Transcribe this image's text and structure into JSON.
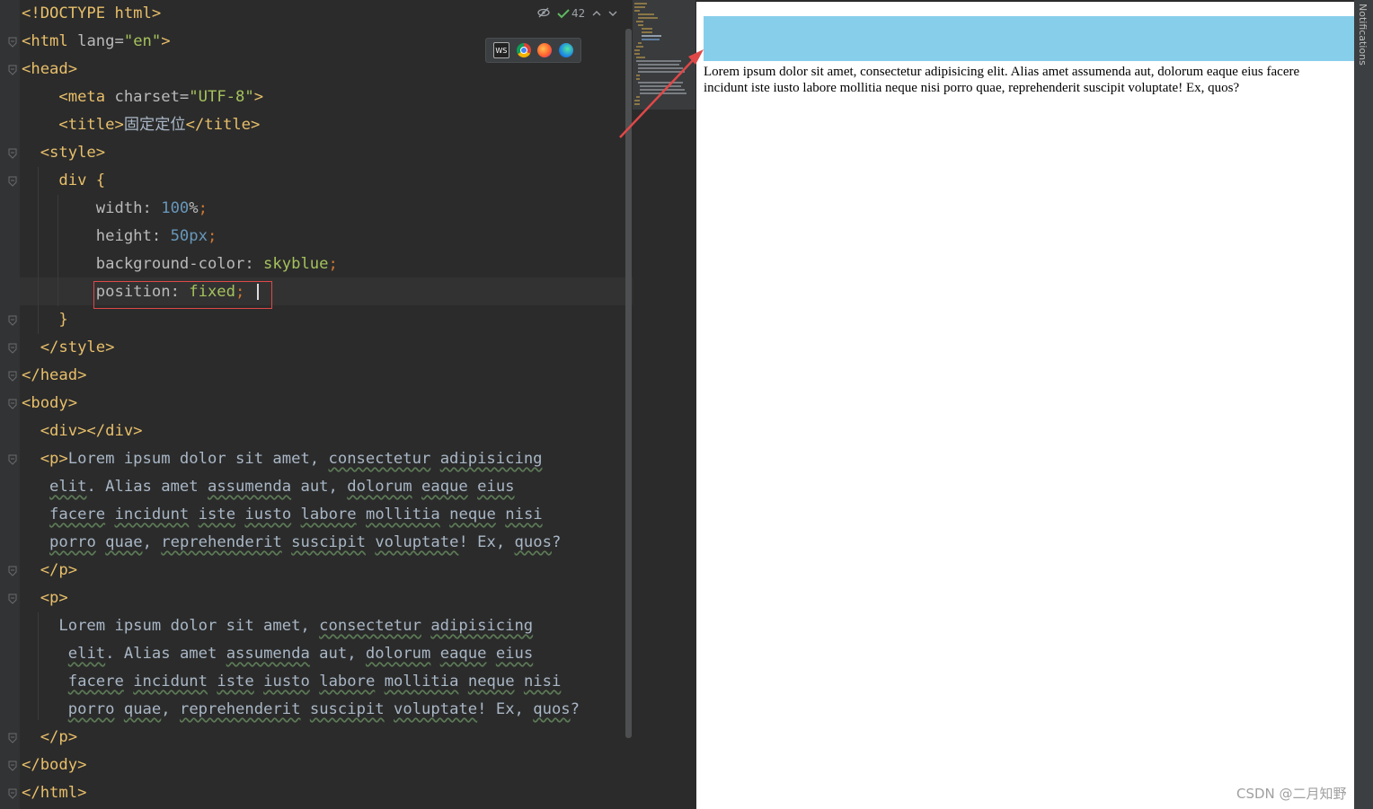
{
  "editor": {
    "lines": [
      {
        "parts": [
          {
            "t": "<!DOCTYPE html>",
            "c": "t"
          }
        ]
      },
      {
        "parts": [
          {
            "t": "<html ",
            "c": "t"
          },
          {
            "t": "lang=",
            "c": "a"
          },
          {
            "t": "\"en\"",
            "c": "s"
          },
          {
            "t": ">",
            "c": "t"
          }
        ]
      },
      {
        "parts": [
          {
            "t": "<head>",
            "c": "t"
          }
        ]
      },
      {
        "parts": [
          {
            "t": "    <meta ",
            "c": "t"
          },
          {
            "t": "charset=",
            "c": "a"
          },
          {
            "t": "\"UTF-8\"",
            "c": "s"
          },
          {
            "t": ">",
            "c": "t"
          }
        ]
      },
      {
        "parts": [
          {
            "t": "    <title>",
            "c": "t"
          },
          {
            "t": "固定定位",
            "c": "tx"
          },
          {
            "t": "</title>",
            "c": "t"
          }
        ]
      },
      {
        "parts": [
          {
            "t": "  <style>",
            "c": "t"
          }
        ]
      },
      {
        "parts": [
          {
            "t": "    div {",
            "c": "t"
          }
        ]
      },
      {
        "parts": [
          {
            "t": "        width: ",
            "c": "a"
          },
          {
            "t": "100",
            "c": "n"
          },
          {
            "t": "%",
            "c": "a"
          },
          {
            "t": ";",
            "c": "k"
          }
        ]
      },
      {
        "parts": [
          {
            "t": "        height: ",
            "c": "a"
          },
          {
            "t": "50px",
            "c": "n"
          },
          {
            "t": ";",
            "c": "k"
          }
        ]
      },
      {
        "parts": [
          {
            "t": "        background-color: ",
            "c": "a"
          },
          {
            "t": "skyblue",
            "c": "s"
          },
          {
            "t": ";",
            "c": "k"
          }
        ]
      },
      {
        "parts": [
          {
            "t": "        position: ",
            "c": "a"
          },
          {
            "t": "fixed",
            "c": "s"
          },
          {
            "t": ";",
            "c": "k"
          }
        ]
      },
      {
        "parts": [
          {
            "t": "    }",
            "c": "t"
          }
        ]
      },
      {
        "parts": [
          {
            "t": "  </style>",
            "c": "t"
          }
        ]
      },
      {
        "parts": [
          {
            "t": "</head>",
            "c": "t"
          }
        ]
      },
      {
        "parts": [
          {
            "t": "<body>",
            "c": "t"
          }
        ]
      },
      {
        "parts": [
          {
            "t": "  <div></div>",
            "c": "t"
          }
        ]
      },
      {
        "parts": [
          {
            "t": "  <p>",
            "c": "t"
          },
          {
            "t": "Lorem ipsum dolor sit amet, ",
            "c": "tx"
          },
          {
            "t": "consectetur",
            "c": "tx u"
          },
          {
            "t": " ",
            "c": "tx"
          },
          {
            "t": "adipisicing",
            "c": "tx u"
          }
        ]
      },
      {
        "parts": [
          {
            "t": "   ",
            "c": "tx"
          },
          {
            "t": "elit",
            "c": "tx u"
          },
          {
            "t": ". Alias amet ",
            "c": "tx"
          },
          {
            "t": "assumenda",
            "c": "tx u"
          },
          {
            "t": " aut, ",
            "c": "tx"
          },
          {
            "t": "dolorum",
            "c": "tx u"
          },
          {
            "t": " ",
            "c": "tx"
          },
          {
            "t": "eaque",
            "c": "tx u"
          },
          {
            "t": " ",
            "c": "tx"
          },
          {
            "t": "eius",
            "c": "tx u"
          }
        ]
      },
      {
        "parts": [
          {
            "t": "   ",
            "c": "tx"
          },
          {
            "t": "facere",
            "c": "tx u"
          },
          {
            "t": " ",
            "c": "tx"
          },
          {
            "t": "incidunt",
            "c": "tx u"
          },
          {
            "t": " ",
            "c": "tx"
          },
          {
            "t": "iste",
            "c": "tx u"
          },
          {
            "t": " ",
            "c": "tx"
          },
          {
            "t": "iusto",
            "c": "tx u"
          },
          {
            "t": " ",
            "c": "tx"
          },
          {
            "t": "labore",
            "c": "tx u"
          },
          {
            "t": " ",
            "c": "tx"
          },
          {
            "t": "mollitia",
            "c": "tx u"
          },
          {
            "t": " ",
            "c": "tx"
          },
          {
            "t": "neque",
            "c": "tx u"
          },
          {
            "t": " ",
            "c": "tx"
          },
          {
            "t": "nisi",
            "c": "tx u"
          }
        ]
      },
      {
        "parts": [
          {
            "t": "   ",
            "c": "tx"
          },
          {
            "t": "porro",
            "c": "tx u"
          },
          {
            "t": " ",
            "c": "tx"
          },
          {
            "t": "quae",
            "c": "tx u"
          },
          {
            "t": ", ",
            "c": "tx"
          },
          {
            "t": "reprehenderit",
            "c": "tx u"
          },
          {
            "t": " ",
            "c": "tx"
          },
          {
            "t": "suscipit",
            "c": "tx u"
          },
          {
            "t": " ",
            "c": "tx"
          },
          {
            "t": "voluptate",
            "c": "tx u"
          },
          {
            "t": "! Ex, ",
            "c": "tx"
          },
          {
            "t": "quos",
            "c": "tx u"
          },
          {
            "t": "?",
            "c": "tx"
          }
        ]
      },
      {
        "parts": [
          {
            "t": "  </p>",
            "c": "t"
          }
        ]
      },
      {
        "parts": [
          {
            "t": "  <p>",
            "c": "t"
          }
        ]
      },
      {
        "parts": [
          {
            "t": "    Lorem ipsum dolor sit amet, ",
            "c": "tx"
          },
          {
            "t": "consectetur",
            "c": "tx u"
          },
          {
            "t": " ",
            "c": "tx"
          },
          {
            "t": "adipisicing",
            "c": "tx u"
          }
        ]
      },
      {
        "parts": [
          {
            "t": "     ",
            "c": "tx"
          },
          {
            "t": "elit",
            "c": "tx u"
          },
          {
            "t": ". Alias amet ",
            "c": "tx"
          },
          {
            "t": "assumenda",
            "c": "tx u"
          },
          {
            "t": " aut, ",
            "c": "tx"
          },
          {
            "t": "dolorum",
            "c": "tx u"
          },
          {
            "t": " ",
            "c": "tx"
          },
          {
            "t": "eaque",
            "c": "tx u"
          },
          {
            "t": " ",
            "c": "tx"
          },
          {
            "t": "eius",
            "c": "tx u"
          }
        ]
      },
      {
        "parts": [
          {
            "t": "     ",
            "c": "tx"
          },
          {
            "t": "facere",
            "c": "tx u"
          },
          {
            "t": " ",
            "c": "tx"
          },
          {
            "t": "incidunt",
            "c": "tx u"
          },
          {
            "t": " ",
            "c": "tx"
          },
          {
            "t": "iste",
            "c": "tx u"
          },
          {
            "t": " ",
            "c": "tx"
          },
          {
            "t": "iusto",
            "c": "tx u"
          },
          {
            "t": " ",
            "c": "tx"
          },
          {
            "t": "labore",
            "c": "tx u"
          },
          {
            "t": " ",
            "c": "tx"
          },
          {
            "t": "mollitia",
            "c": "tx u"
          },
          {
            "t": " ",
            "c": "tx"
          },
          {
            "t": "neque",
            "c": "tx u"
          },
          {
            "t": " ",
            "c": "tx"
          },
          {
            "t": "nisi",
            "c": "tx u"
          }
        ]
      },
      {
        "parts": [
          {
            "t": "     ",
            "c": "tx"
          },
          {
            "t": "porro",
            "c": "tx u"
          },
          {
            "t": " ",
            "c": "tx"
          },
          {
            "t": "quae",
            "c": "tx u"
          },
          {
            "t": ", ",
            "c": "tx"
          },
          {
            "t": "reprehenderit",
            "c": "tx u"
          },
          {
            "t": " ",
            "c": "tx"
          },
          {
            "t": "suscipit",
            "c": "tx u"
          },
          {
            "t": " ",
            "c": "tx"
          },
          {
            "t": "voluptate",
            "c": "tx u"
          },
          {
            "t": "! Ex, ",
            "c": "tx"
          },
          {
            "t": "quos",
            "c": "tx u"
          },
          {
            "t": "?",
            "c": "tx"
          }
        ]
      },
      {
        "parts": [
          {
            "t": "  </p>",
            "c": "t"
          }
        ]
      },
      {
        "parts": [
          {
            "t": "</body>",
            "c": "t"
          }
        ]
      },
      {
        "parts": [
          {
            "t": "</html>",
            "c": "t"
          }
        ]
      }
    ],
    "inspection_count": "42",
    "browser_icons": [
      "WS",
      "chrome",
      "firefox",
      "edge"
    ]
  },
  "preview": {
    "paragraph": "Lorem ipsum dolor sit amet, consectetur adipisicing elit. Alias amet assumenda aut, dolorum eaque eius facere incidunt iste iusto labore mollitia neque nisi porro quae, reprehenderit suscipit voluptate! Ex, quos?",
    "bar_color": "#87ceeb"
  },
  "sidebar": {
    "notifications_label": "Notifications"
  },
  "watermark": "CSDN @二月知野",
  "annotation_color": "#e04848"
}
